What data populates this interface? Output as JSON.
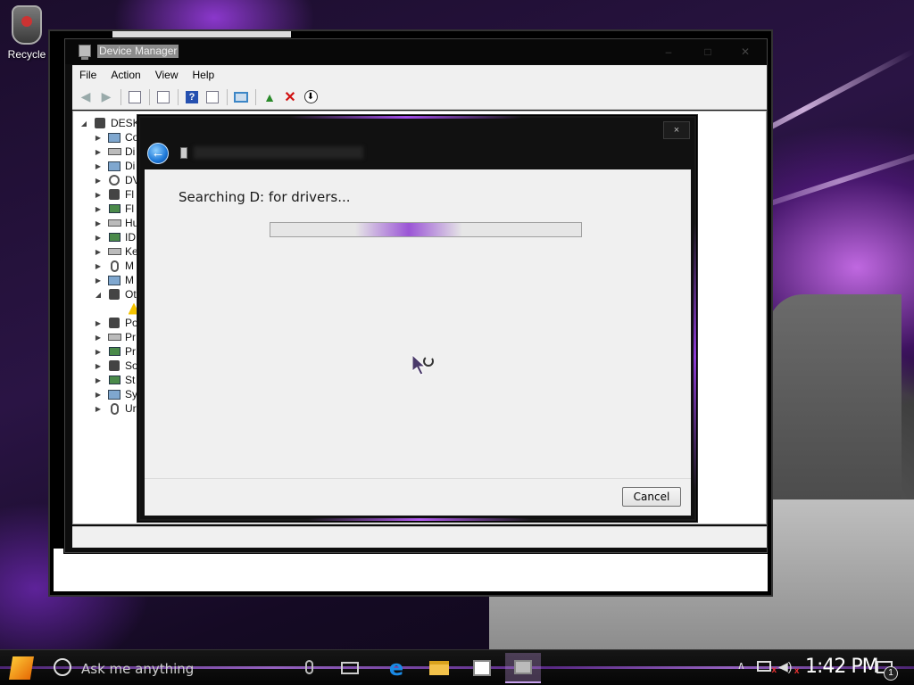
{
  "desktop": {
    "icons": [
      {
        "label": "Recycle"
      }
    ]
  },
  "device_manager": {
    "title": "Device Manager",
    "menu": [
      "File",
      "Action",
      "View",
      "Help"
    ],
    "tree": {
      "root": "DESKT",
      "items": [
        {
          "label": "Co",
          "icon": "monitor-icon",
          "expanded": false
        },
        {
          "label": "Di",
          "icon": "disk-drive-icon",
          "expanded": false
        },
        {
          "label": "Di",
          "icon": "display-adapter-icon",
          "expanded": false
        },
        {
          "label": "DV",
          "icon": "dvd-drive-icon",
          "expanded": false
        },
        {
          "label": "Fl",
          "icon": "firmware-icon",
          "expanded": false
        },
        {
          "label": "Fl",
          "icon": "floppy-icon",
          "expanded": false
        },
        {
          "label": "Hu",
          "icon": "hid-icon",
          "expanded": false
        },
        {
          "label": "ID",
          "icon": "ide-controller-icon",
          "expanded": false
        },
        {
          "label": "Ke",
          "icon": "keyboard-icon",
          "expanded": false
        },
        {
          "label": "M",
          "icon": "mouse-icon",
          "expanded": false
        },
        {
          "label": "M",
          "icon": "monitor-icon",
          "expanded": false
        },
        {
          "label": "Ot",
          "icon": "other-devices-icon",
          "expanded": true
        },
        {
          "label": "Po",
          "icon": "port-icon",
          "expanded": false
        },
        {
          "label": "Pr",
          "icon": "printer-icon",
          "expanded": false
        },
        {
          "label": "Pr",
          "icon": "processor-icon",
          "expanded": false
        },
        {
          "label": "So",
          "icon": "sound-icon",
          "expanded": false
        },
        {
          "label": "St",
          "icon": "storage-icon",
          "expanded": false
        },
        {
          "label": "Sy",
          "icon": "system-icon",
          "expanded": false
        },
        {
          "label": "Ur",
          "icon": "usb-icon",
          "expanded": false
        }
      ]
    }
  },
  "wizard": {
    "close_label": "×",
    "back_label": "←",
    "status_text": "Searching D: for drivers...",
    "cancel_label": "Cancel",
    "accent_color": "#9b55d6"
  },
  "taskbar": {
    "search_placeholder": "Ask me anything",
    "time": "1:42 PM",
    "notification_count": "1"
  }
}
